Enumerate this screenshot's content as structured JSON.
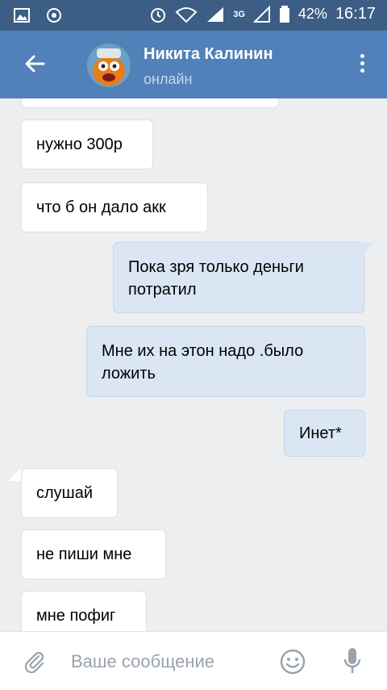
{
  "status_bar": {
    "battery_percent": "42%",
    "time": "16:17",
    "network_label": "3G",
    "icons": [
      "gallery-icon",
      "location-icon",
      "alarm-icon",
      "wifi-icon",
      "signal-icon",
      "battery-icon"
    ]
  },
  "header": {
    "contact_name": "Никита Калинин",
    "contact_status": "онлайн",
    "colors": {
      "bar": "#5181b8",
      "status_bar": "#3c5e85"
    }
  },
  "messages": [
    {
      "direction": "in",
      "text": ""
    },
    {
      "direction": "in",
      "text": "нужно 300р"
    },
    {
      "direction": "in",
      "text": "что б он дало акк"
    },
    {
      "direction": "out",
      "text": "Пока зря только деньги потратил"
    },
    {
      "direction": "out",
      "text": "Мне их на этон надо .было ложить"
    },
    {
      "direction": "out",
      "text": "Инет*"
    },
    {
      "direction": "in",
      "text": "слушай"
    },
    {
      "direction": "in",
      "text": "не пиши мне"
    },
    {
      "direction": "in",
      "text": "мне пофиг"
    }
  ],
  "composer": {
    "placeholder": "Ваше сообщение",
    "value": ""
  }
}
